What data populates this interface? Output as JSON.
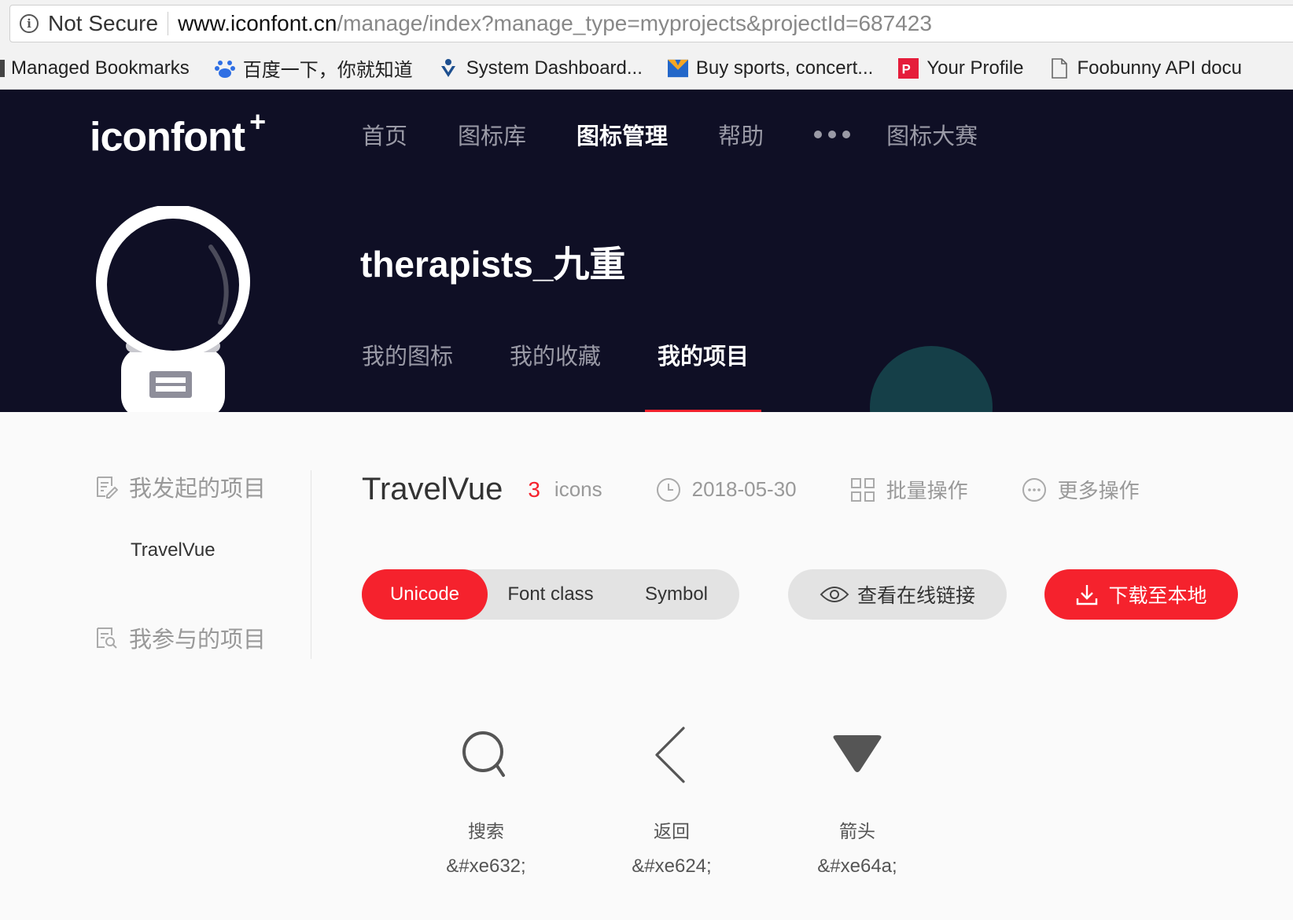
{
  "browser": {
    "security_label": "Not Secure",
    "url_host": "www.iconfont.cn",
    "url_path": "/manage/index?manage_type=myprojects&projectId=687423",
    "bookmarks": [
      {
        "label": "Managed Bookmarks",
        "icon": "folder-icon"
      },
      {
        "label": "百度一下，你就知道",
        "icon": "baidu-paw-icon"
      },
      {
        "label": "System Dashboard...",
        "icon": "jira-icon"
      },
      {
        "label": "Buy sports, concert...",
        "icon": "ticket-site-icon"
      },
      {
        "label": "Your Profile",
        "icon": "profile-site-icon"
      },
      {
        "label": "Foobunny API docu",
        "icon": "document-icon"
      }
    ]
  },
  "site": {
    "logo": "iconfont",
    "logo_mark": "+",
    "nav": [
      "首页",
      "图标库",
      "图标管理",
      "帮助",
      "图标大赛"
    ],
    "active_nav": "图标管理",
    "username": "therapists_九重",
    "subtabs": [
      "我的图标",
      "我的收藏",
      "我的项目"
    ],
    "active_subtab": "我的项目"
  },
  "sidebar": {
    "group_started": "我发起的项目",
    "project": "TravelVue",
    "group_joined": "我参与的项目"
  },
  "project": {
    "title": "TravelVue",
    "icon_count": "3",
    "icon_count_unit": "icons",
    "date": "2018-05-30",
    "batch_label": "批量操作",
    "more_label": "更多操作"
  },
  "toolbar": {
    "modes": [
      "Unicode",
      "Font class",
      "Symbol"
    ],
    "active_mode": "Unicode",
    "online_link_label": "查看在线链接",
    "download_label": "下载至本地"
  },
  "icons": [
    {
      "name": "搜索",
      "code": "&#xe632;",
      "icon": "search-icon"
    },
    {
      "name": "返回",
      "code": "&#xe624;",
      "icon": "back-chevron-icon"
    },
    {
      "name": "箭头",
      "code": "&#xe64a;",
      "icon": "down-triangle-icon"
    }
  ],
  "colors": {
    "accent": "#f5222d",
    "hero_bg": "#0f0f25"
  }
}
